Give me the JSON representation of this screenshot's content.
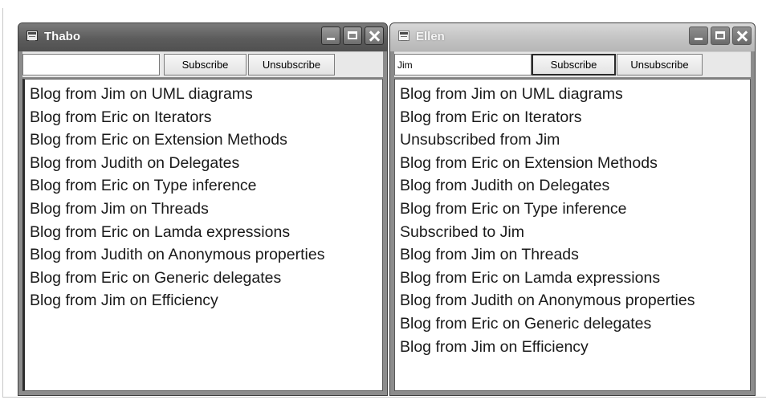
{
  "windows": [
    {
      "title": "Thabo",
      "topic_value": "",
      "subscribe_label": "Subscribe",
      "unsubscribe_label": "Unsubscribe",
      "messages": [
        "Blog from Jim on UML diagrams",
        "Blog from Eric on Iterators",
        "Blog from Eric on Extension Methods",
        "Blog from Judith on Delegates",
        "Blog from Eric on Type inference",
        "Blog from Jim on Threads",
        "Blog from Eric on Lamda expressions",
        "Blog from Judith on Anonymous properties",
        "Blog from Eric on Generic delegates",
        "Blog from Jim on Efficiency"
      ]
    },
    {
      "title": "Ellen",
      "topic_value": "Jim",
      "subscribe_label": "Subscribe",
      "unsubscribe_label": "Unsubscribe",
      "messages": [
        "Blog from Jim on UML diagrams",
        "Blog from Eric on Iterators",
        "Unsubscribed from Jim",
        "Blog from Eric on Extension Methods",
        "Blog from Judith on Delegates",
        "Blog from Eric on Type inference",
        "Subscribed to Jim",
        "Blog from Jim on Threads",
        "Blog from Eric on Lamda expressions",
        "Blog from Judith on Anonymous properties",
        "Blog from Eric on Generic delegates",
        "Blog from Jim on Efficiency"
      ]
    }
  ],
  "icons": {
    "app": "app-window-icon",
    "minimize": "minimize-icon",
    "maximize": "maximize-icon",
    "close": "close-icon"
  }
}
